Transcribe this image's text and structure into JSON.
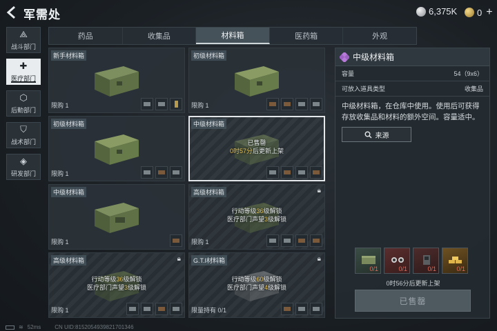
{
  "header": {
    "title": "军需处",
    "currencies": [
      {
        "icon": "silver-coin-icon",
        "value": "6,375K"
      },
      {
        "icon": "gold-coin-icon",
        "value": "0"
      }
    ],
    "plus": "+"
  },
  "sidenav": {
    "items": [
      {
        "label": "战斗部门",
        "icon": "combat-icon",
        "glyph": "⟁"
      },
      {
        "label": "医疗部门",
        "icon": "medical-cross-icon",
        "glyph": "✚",
        "active": true
      },
      {
        "label": "后勤部门",
        "icon": "logistics-icon",
        "glyph": "⬡"
      },
      {
        "label": "战术部门",
        "icon": "tactical-shield-icon",
        "glyph": "⛉"
      },
      {
        "label": "研发部门",
        "icon": "research-icon",
        "glyph": "◈"
      }
    ]
  },
  "tabs": [
    "药品",
    "收集品",
    "材料箱",
    "医药箱",
    "外观"
  ],
  "active_tab": "材料箱",
  "cards": [
    {
      "name": "新手材料箱",
      "limit": "限购 1",
      "box_color": "#5e7048"
    },
    {
      "name": "初级材料箱",
      "limit": "限购 1",
      "box_color": "#6b7c4f"
    },
    {
      "name": "初级材料箱",
      "limit": "限购 1",
      "box_color": "#6b7c4f"
    },
    {
      "name": "中级材料箱",
      "limit": "",
      "box_color": "#6b7c4f",
      "overlay": [
        "已售罄",
        "0时57分",
        "后更新上架"
      ]
    },
    {
      "name": "中级材料箱",
      "limit": "限购 1",
      "box_color": "#5d6f4a"
    },
    {
      "name": "高级材料箱",
      "limit": "限购 1",
      "box_color": "#59673f",
      "overlay": [
        "行动等级",
        "36",
        "级解锁",
        "医疗部门声望",
        "3",
        "级解锁"
      ]
    },
    {
      "name": "高级材料箱",
      "limit": "限购 1",
      "box_color": "#5d6a43",
      "overlay": [
        "行动等级",
        "36",
        "级解锁",
        "医疗部门声望",
        "3",
        "级解锁"
      ]
    },
    {
      "name": "G.T.I材料箱",
      "limit": "限量持有 0/1",
      "box_color": "#6a6e70",
      "overlay": [
        "行动等级",
        "60",
        "级解锁",
        "医疗部门声望",
        "4",
        "级解锁"
      ]
    }
  ],
  "detail": {
    "title": "中级材料箱",
    "rows": [
      {
        "label": "容量",
        "value": "54（9x6）"
      },
      {
        "label": "可放入道具类型",
        "value": "收集品"
      }
    ],
    "description": "中级材料箱，在仓库中使用。使用后可获得存放收集品和材料的额外空间。容量适中。",
    "source_label": "来源",
    "contents": [
      {
        "qty": "0/1"
      },
      {
        "qty": "0/1"
      },
      {
        "qty": "0/1"
      },
      {
        "qty": "0/1"
      }
    ],
    "refresh_note": "0时56分后更新上架",
    "buy_label": "已售罄"
  },
  "status": {
    "ping": "52ms",
    "uid": "CN UID:8152054939821701346"
  },
  "colors": {
    "accent_gold": "#e9c55b",
    "rarity_purple": "#b77ad8",
    "qty_red": "#e26a5a"
  }
}
